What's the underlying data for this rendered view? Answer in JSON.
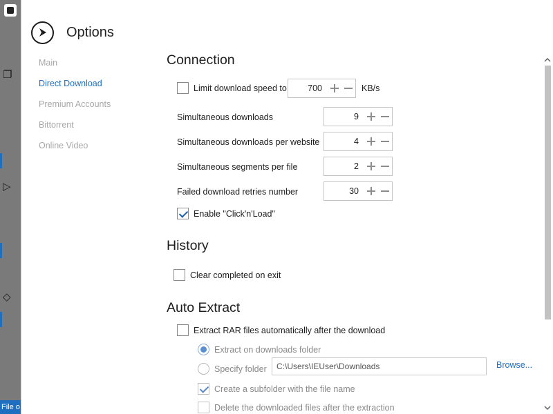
{
  "background_app": {
    "status_text": "File o"
  },
  "dialog": {
    "title": "Options"
  },
  "nav": {
    "items": [
      {
        "label": "Main",
        "active": false
      },
      {
        "label": "Direct Download",
        "active": true
      },
      {
        "label": "Premium Accounts",
        "active": false
      },
      {
        "label": "Bittorrent",
        "active": false
      },
      {
        "label": "Online Video",
        "active": false
      }
    ]
  },
  "connection": {
    "title": "Connection",
    "limit_speed": {
      "label": "Limit download speed to",
      "checked": false,
      "value": "700",
      "unit": "KB/s"
    },
    "simultaneous_downloads": {
      "label": "Simultaneous downloads",
      "value": "9"
    },
    "per_website": {
      "label": "Simultaneous downloads per website",
      "value": "4"
    },
    "segments": {
      "label": "Simultaneous segments per file",
      "value": "2"
    },
    "retries": {
      "label": "Failed download retries number",
      "value": "30"
    },
    "click_n_load": {
      "label": "Enable \"Click'n'Load\"",
      "checked": true
    }
  },
  "history": {
    "title": "History",
    "clear_on_exit": {
      "label": "Clear completed on exit",
      "checked": false
    }
  },
  "auto_extract": {
    "title": "Auto Extract",
    "extract_rar": {
      "label": "Extract RAR files automatically after the download",
      "checked": false
    },
    "extract_on_downloads": {
      "label": "Extract on downloads folder",
      "selected": true
    },
    "specify_folder": {
      "label": "Specify folder",
      "selected": false,
      "path": "C:\\Users\\IEUser\\Downloads",
      "browse_label": "Browse..."
    },
    "create_subfolder": {
      "label": "Create a subfolder with the file name",
      "checked": true
    },
    "delete_after": {
      "label": "Delete the downloaded files after the extraction",
      "checked": false
    }
  },
  "colors": {
    "accent": "#1e6fc0",
    "nav_inactive": "#a8a8a8",
    "background_strip": "#7a7a7a"
  }
}
